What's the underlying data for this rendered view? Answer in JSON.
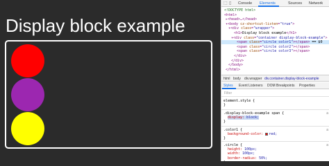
{
  "page": {
    "title": "Display block example",
    "circle_colors": [
      "#ff0000",
      "#9c27b0",
      "#ffff00"
    ]
  },
  "devtools": {
    "tabs": [
      "Console",
      "Elements",
      "Sources",
      "Network"
    ],
    "active_tab": "Elements",
    "dom_lines": [
      {
        "parts": [
          {
            "c": "comment",
            "t": "<!DOCTYPE html>"
          }
        ]
      },
      {
        "parts": [
          {
            "c": "tag",
            "t": "<html>"
          }
        ]
      },
      {
        "parts": [
          {
            "c": "tag",
            "t": "▸<head>…</head>"
          }
        ]
      },
      {
        "parts": [
          {
            "c": "tag",
            "t": "▾<body "
          },
          {
            "c": "attr",
            "t": "cz-shortcut-listen"
          },
          {
            "c": "tag",
            "t": "="
          },
          {
            "c": "val",
            "t": "\"true\""
          },
          {
            "c": "tag",
            "t": ">"
          }
        ]
      },
      {
        "parts": [
          {
            "c": "tag",
            "t": "▾<div "
          },
          {
            "c": "attr",
            "t": "class"
          },
          {
            "c": "tag",
            "t": "="
          },
          {
            "c": "val",
            "t": "\"wrapper\""
          },
          {
            "c": "tag",
            "t": ">"
          }
        ]
      },
      {
        "parts": [
          {
            "c": "tag",
            "t": "<h1>"
          },
          {
            "c": "text",
            "t": "Display block example"
          },
          {
            "c": "tag",
            "t": "</h1>"
          }
        ]
      },
      {
        "parts": [
          {
            "c": "tag",
            "t": "▾<div "
          },
          {
            "c": "attr",
            "t": "class"
          },
          {
            "c": "tag",
            "t": "="
          },
          {
            "c": "val",
            "t": "\"container display-block-example\""
          },
          {
            "c": "tag",
            "t": ">"
          }
        ]
      },
      {
        "parts": [
          {
            "c": "tag",
            "t": "<span "
          },
          {
            "c": "attr",
            "t": "class"
          },
          {
            "c": "tag",
            "t": "="
          },
          {
            "c": "val",
            "t": "\"circle color1\""
          },
          {
            "c": "tag",
            "t": "></span>"
          },
          {
            "c": "text",
            "t": " == $0"
          }
        ]
      },
      {
        "parts": [
          {
            "c": "tag",
            "t": "<span "
          },
          {
            "c": "attr",
            "t": "class"
          },
          {
            "c": "tag",
            "t": "="
          },
          {
            "c": "val",
            "t": "\"circle color2\""
          },
          {
            "c": "tag",
            "t": "></span>"
          }
        ]
      },
      {
        "parts": [
          {
            "c": "tag",
            "t": "<span "
          },
          {
            "c": "attr",
            "t": "class"
          },
          {
            "c": "tag",
            "t": "="
          },
          {
            "c": "val",
            "t": "\"circle color3\""
          },
          {
            "c": "tag",
            "t": "></span>"
          }
        ]
      },
      {
        "parts": [
          {
            "c": "tag",
            "t": "</div>"
          }
        ]
      },
      {
        "parts": [
          {
            "c": "tag",
            "t": "</div>"
          }
        ]
      },
      {
        "parts": [
          {
            "c": "tag",
            "t": "</body>"
          }
        ]
      },
      {
        "parts": [
          {
            "c": "tag",
            "t": "</html>"
          }
        ]
      }
    ],
    "breadcrumbs": [
      "html",
      "body",
      "div.wrapper",
      "div.container.display-block-example"
    ],
    "subtabs": [
      "Styles",
      "Event Listeners",
      "DOM Breakpoints",
      "Properties"
    ],
    "filter_placeholder": "Filter",
    "rules": [
      {
        "lines": [
          "element.style {",
          "}"
        ]
      },
      {
        "lines": [
          ".display-block-example span {",
          "display: block;",
          "}"
        ],
        "src": "a"
      },
      {
        "lines": [
          ".color1 {",
          "background-color: red;",
          "}"
        ],
        "src": "a"
      },
      {
        "lines": [
          ".circle {",
          "height: 100px;",
          "width: 100px;",
          "border-radius: 50%;",
          "}"
        ],
        "src": "a"
      }
    ]
  }
}
